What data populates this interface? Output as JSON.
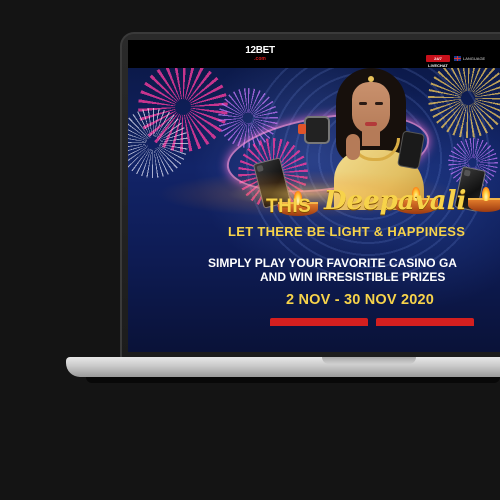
{
  "site": {
    "logo_main": "12BET",
    "logo_sub": ".com",
    "livechat_label": "24/7 LIVECHAT",
    "language_label": "LANGUAGE"
  },
  "banner": {
    "headline_prefix": "THIS",
    "headline_script": "Deepavali",
    "subheadline": "LET THERE BE LIGHT & HAPPINESS",
    "body_line1": "SIMPLY PLAY YOUR FAVORITE CASINO GA",
    "body_line2": "AND WIN IRRESISTIBLE PRIZES",
    "dates": "2 NOV - 30 NOV 2020"
  },
  "colors": {
    "accent_gold": "#f7d34a",
    "brand_red": "#d41f1f",
    "background": "#141414"
  },
  "icons": [
    "flag-icon",
    "smartwatch-icon",
    "smartphone-icon",
    "diya-lamp-icon"
  ]
}
